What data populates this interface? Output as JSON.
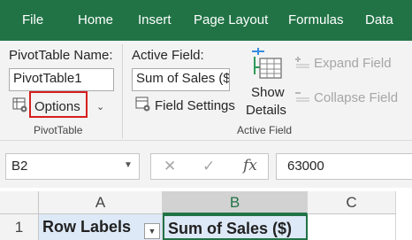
{
  "menu": {
    "file": "File",
    "home": "Home",
    "insert": "Insert",
    "page_layout": "Page Layout",
    "formulas": "Formulas",
    "data": "Data"
  },
  "ribbon": {
    "pivottable_group": {
      "name_label": "PivotTable Name:",
      "name_value": "PivotTable1",
      "options_label": "Options",
      "group_label": "PivotTable"
    },
    "active_field_group": {
      "field_label": "Active Field:",
      "field_value": "Sum of Sales ($)",
      "field_settings_label": "Field Settings",
      "show_details_line1": "Show",
      "show_details_line2": "Details",
      "expand_field_label": "Expand Field",
      "collapse_field_label": "Collapse Field",
      "group_label": "Active Field"
    }
  },
  "formula_bar": {
    "name_box": "B2",
    "fx": "fx",
    "content": "63000"
  },
  "grid": {
    "columns": [
      "A",
      "B",
      "C"
    ],
    "row_number": "1",
    "cell_a1": "Row Labels",
    "cell_b1": "Sum of Sales ($)"
  },
  "colors": {
    "excel_green": "#217346",
    "highlight_red": "#d71e1e",
    "pivot_fill": "#dde9f7"
  }
}
